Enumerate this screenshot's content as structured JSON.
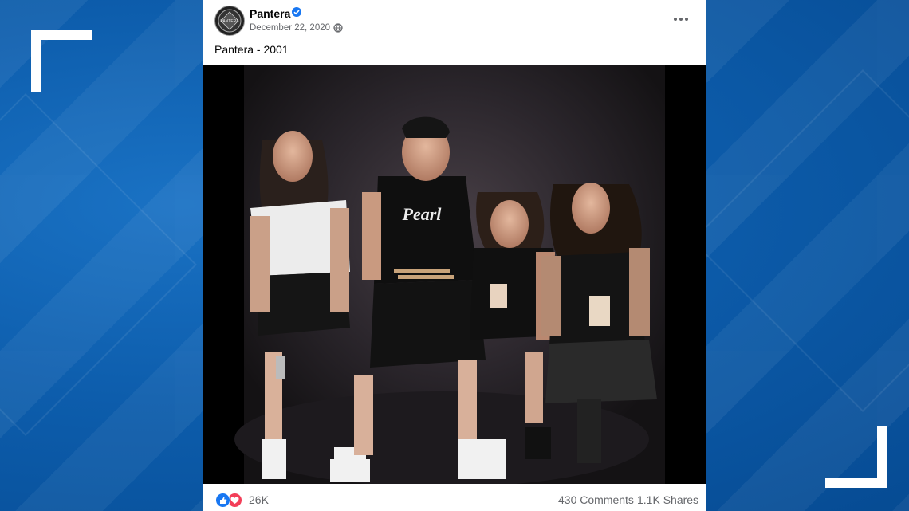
{
  "post": {
    "page_name": "Pantera",
    "date": "December 22, 2020",
    "caption": "Pantera - 2001",
    "avatar_text": "PANTERA",
    "reactions_count": "26K",
    "comments": "430 Comments",
    "shares": "1.1K Shares",
    "photo_alt": "Pearl"
  },
  "icons": {
    "verified": "verified-badge-icon",
    "privacy": "globe-icon",
    "more": "more-options-icon",
    "like": "like-reaction-icon",
    "love": "love-reaction-icon"
  },
  "colors": {
    "background_blue": "#0b5aa8",
    "facebook_blue": "#1877f2",
    "love_red": "#f33e58",
    "secondary_text": "#65676b"
  }
}
